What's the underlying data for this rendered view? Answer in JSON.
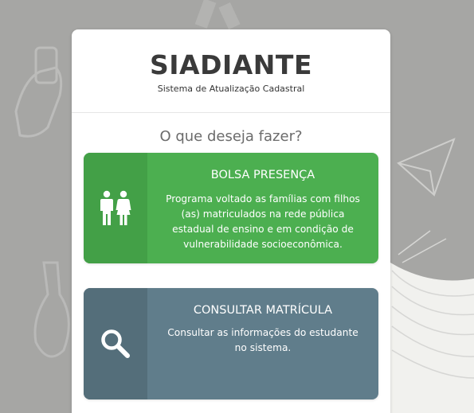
{
  "app": {
    "logo": "SIADIANTE",
    "subtitle": "Sistema de Atualização Cadastral"
  },
  "prompt": "O que deseja fazer?",
  "options": [
    {
      "title": "BOLSA PRESENÇA",
      "description": "Programa voltado as famílias com filhos (as) matriculados na rede pública estadual de ensino e em condição de vulnerabilidade socioeconômica.",
      "icon": "family-icon",
      "color": "#4caf50",
      "icon_bg": "#43a047"
    },
    {
      "title": "CONSULTAR MATRÍCULA",
      "description": "Consultar as informações do estudante no sistema.",
      "icon": "search-icon",
      "color": "#607d8b",
      "icon_bg": "#546e7a"
    }
  ]
}
